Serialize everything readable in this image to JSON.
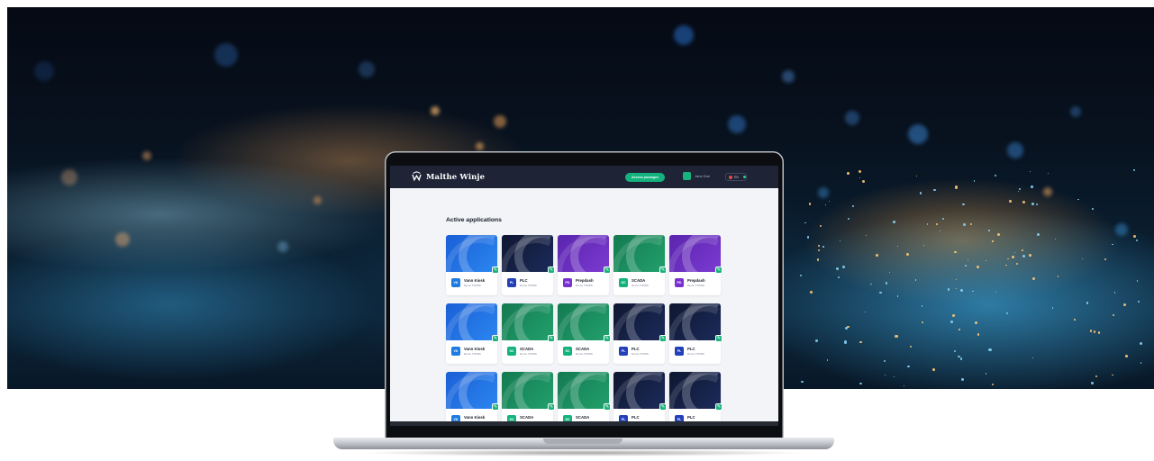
{
  "header": {
    "brand": "Malthe Winje",
    "access_button": "Access packages",
    "user_name": "Jane Doe",
    "language": "EN"
  },
  "main": {
    "section_title": "Active applications",
    "rows": [
      [
        {
          "badge": "VK",
          "name": "Vann Kiosk",
          "sub": "Demo TSNNK",
          "theme": "blue"
        },
        {
          "badge": "PL",
          "name": "PLC",
          "sub": "Demo TSNNK",
          "theme": "navy"
        },
        {
          "badge": "PD",
          "name": "Prepdash",
          "sub": "Demo TSNNK",
          "theme": "purple"
        },
        {
          "badge": "SC",
          "name": "SCADA",
          "sub": "Demo TSNNK",
          "theme": "green"
        },
        {
          "badge": "PD",
          "name": "Prepdash",
          "sub": "Demo TSNNK",
          "theme": "purple"
        }
      ],
      [
        {
          "badge": "VK",
          "name": "Vann Kiosk",
          "sub": "Demo TSNNK",
          "theme": "blue"
        },
        {
          "badge": "SC",
          "name": "SCADA",
          "sub": "Demo TSNNK",
          "theme": "green"
        },
        {
          "badge": "SC",
          "name": "SCADA",
          "sub": "Demo TSNNK",
          "theme": "green"
        },
        {
          "badge": "PL",
          "name": "PLC",
          "sub": "Demo TSNNK",
          "theme": "navy"
        },
        {
          "badge": "PL",
          "name": "PLC",
          "sub": "Demo TSNNK",
          "theme": "navy"
        }
      ],
      [
        {
          "badge": "VK",
          "name": "Vann Kiosk",
          "sub": "Demo TSNNK",
          "theme": "blue"
        },
        {
          "badge": "SC",
          "name": "SCADA",
          "sub": "Demo TSNNK",
          "theme": "green"
        },
        {
          "badge": "SC",
          "name": "SCADA",
          "sub": "Demo TSNNK",
          "theme": "green"
        },
        {
          "badge": "PL",
          "name": "PLC",
          "sub": "Demo TSNNK",
          "theme": "navy"
        },
        {
          "badge": "PL",
          "name": "PLC",
          "sub": "Demo TSNNK",
          "theme": "navy"
        }
      ]
    ]
  },
  "colors": {
    "header_bg": "#1e2436",
    "accent_green": "#14b37d",
    "screen_bg": "#f2f4f7",
    "theme_blue": "#1f63d6",
    "theme_navy": "#141d3a",
    "theme_purple": "#6a2bb8",
    "theme_green": "#1a8a5c",
    "badge_blue": "#1e7be0",
    "badge_navy": "#2340b8",
    "badge_purple": "#7a2fd0",
    "badge_green": "#14b37d"
  },
  "icons": [
    "logo-mark-icon",
    "edit-icon",
    "flag-icon",
    "status-dot-icon",
    "avatar-icon"
  ]
}
